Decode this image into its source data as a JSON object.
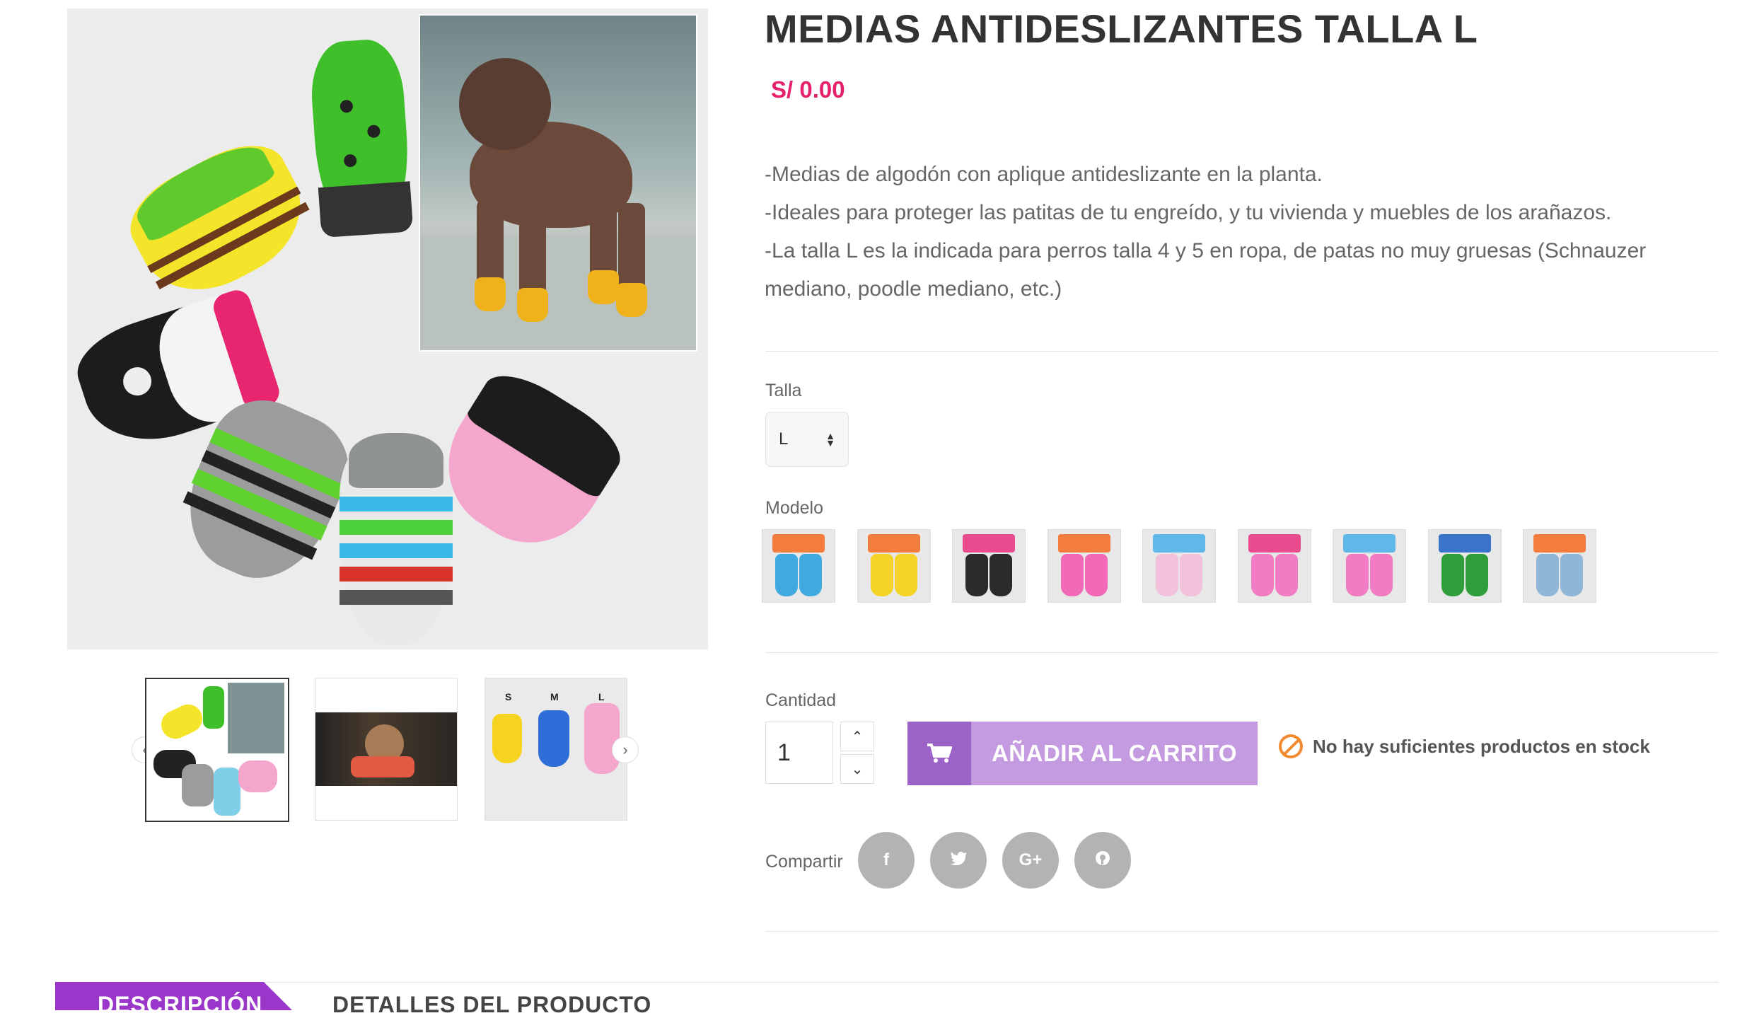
{
  "product": {
    "title": "MEDIAS ANTIDESLIZANTES TALLA L",
    "price": "S/ 0.00",
    "description": [
      "-Medias de algodón con aplique antideslizante en la planta.",
      "-Ideales para proteger las patitas de tu engreído, y tu vivienda y muebles de los arañazos.",
      "-La talla L es la indicada para perros talla 4 y 5 en ropa, de patas no muy gruesas (Schnauzer mediano, poodle mediano, etc.)"
    ]
  },
  "gallery": {
    "thumbnail_labels": [
      "S",
      "M",
      "L"
    ]
  },
  "options": {
    "size_label": "Talla",
    "size_value": "L",
    "model_label": "Modelo",
    "models": [
      {
        "top": "#f47c3c",
        "sock": "#3fa9e0"
      },
      {
        "top": "#f47c3c",
        "sock": "#f5d327"
      },
      {
        "top": "#e94b8f",
        "sock": "#2b2b2b"
      },
      {
        "top": "#f47c3c",
        "sock": "#f26ab7"
      },
      {
        "top": "#5fb8e8",
        "sock": "#f2c1dc"
      },
      {
        "top": "#e94b8f",
        "sock": "#f27cc3"
      },
      {
        "top": "#5fb8e8",
        "sock": "#f27cc3"
      },
      {
        "top": "#3a73c9",
        "sock": "#2f9e3a"
      },
      {
        "top": "#f47c3c",
        "sock": "#8fb6d6"
      }
    ]
  },
  "purchase": {
    "quantity_label": "Cantidad",
    "quantity_value": "1",
    "add_to_cart_label": "AÑADIR AL CARRITO",
    "stock_message": "No hay suficientes productos en stock"
  },
  "share": {
    "label": "Compartir",
    "networks": [
      "f",
      "t",
      "G+",
      "P"
    ]
  },
  "tabs": {
    "description": "DESCRIPCIÓN",
    "details": "DETALLES DEL PRODUCTO"
  },
  "colors": {
    "price": "#e6216c",
    "cart_button": "#c49be0",
    "cart_icon_box": "#9b62c8",
    "tab_active": "#9a36c9",
    "stock_icon": "#f28b2e"
  }
}
